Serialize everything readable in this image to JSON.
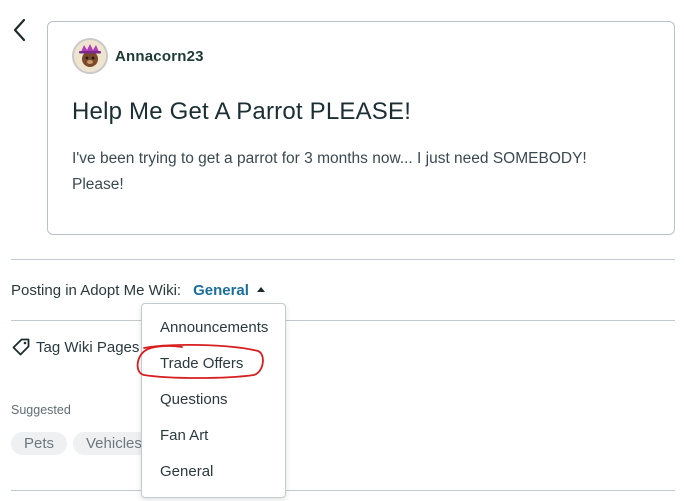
{
  "post": {
    "author": "Annacorn23",
    "title": "Help Me Get A Parrot PLEASE!",
    "body": "I've been trying to get a parrot for 3 months now... I just need SOMEBODY! Please!"
  },
  "posting": {
    "label": "Posting in Adopt Me Wiki:",
    "selected_category": "General"
  },
  "tags": {
    "label": "Tag Wiki Pages"
  },
  "suggested": {
    "label": "Suggested",
    "chips": [
      "Pets",
      "Vehicles"
    ]
  },
  "dropdown": {
    "options": [
      "Announcements",
      "Trade Offers",
      "Questions",
      "Fan Art",
      "General"
    ],
    "circled_option": "Trade Offers"
  },
  "icons": {
    "back": "chevron-left-icon",
    "tag": "tag-icon",
    "caret": "caret-up-icon"
  },
  "colors": {
    "category_accent": "#1c6f9c",
    "annotation": "#d61f1f"
  }
}
